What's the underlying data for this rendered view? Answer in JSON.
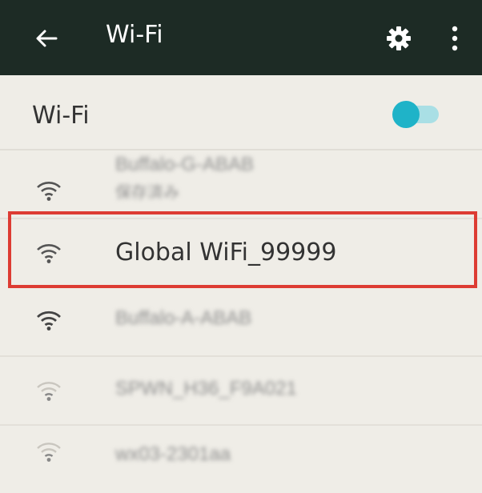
{
  "app_bar": {
    "title": "Wi-Fi",
    "back_icon": "arrow-left",
    "settings_icon": "gear",
    "more_icon": "more-vert"
  },
  "wifi_toggle": {
    "label": "Wi-Fi",
    "on": true,
    "colors": {
      "thumb": "#1fb3c8",
      "track": "#a9dfe5"
    }
  },
  "networks": [
    {
      "name": "Buffalo-G-ABAB",
      "sub": "保存済み",
      "blurred": true,
      "signal": "strong"
    },
    {
      "name": "Global WiFi_99999",
      "blurred": false,
      "highlighted": true,
      "signal": "strong"
    },
    {
      "name": "Buffalo-A-ABAB",
      "blurred": true,
      "signal": "strong"
    },
    {
      "name": "SPWN_H36_F9A021",
      "blurred": true,
      "signal": "weak"
    },
    {
      "name": "wx03-2301aa",
      "blurred": true,
      "signal": "weak"
    }
  ],
  "colors": {
    "app_bar_bg": "#1d2b25",
    "page_bg": "#efede7",
    "highlight_border": "#dd3c33"
  }
}
